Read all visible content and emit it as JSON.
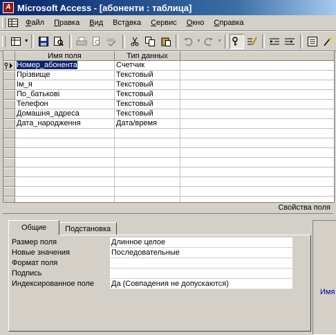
{
  "window": {
    "title": "Microsoft Access - [абоненти : таблица]"
  },
  "menubar": {
    "items": [
      {
        "pre": "",
        "u": "Ф",
        "post": "айл"
      },
      {
        "pre": "",
        "u": "П",
        "post": "равка"
      },
      {
        "pre": "",
        "u": "В",
        "post": "ид"
      },
      {
        "pre": "Вст",
        "u": "а",
        "post": "вка"
      },
      {
        "pre": "",
        "u": "С",
        "post": "ервис"
      },
      {
        "pre": "",
        "u": "О",
        "post": "кно"
      },
      {
        "pre": "",
        "u": "С",
        "post": "правка"
      }
    ]
  },
  "grid": {
    "headers": {
      "field_name": "Имя поля",
      "data_type": "Тип данных",
      "description": ""
    },
    "rows": [
      {
        "name": "Номер_абонента",
        "type": "Счетчик"
      },
      {
        "name": "Прізвище",
        "type": "Текстовый"
      },
      {
        "name": "Ім_я",
        "type": "Текстовый"
      },
      {
        "name": "По_батькові",
        "type": "Текстовый"
      },
      {
        "name": "Телефон",
        "type": "Текстовый"
      },
      {
        "name": "Домашня_адреса",
        "type": "Текстовый"
      },
      {
        "name": "Дата_народження",
        "type": "Дата/время"
      }
    ],
    "empty_row_count": 8
  },
  "properties": {
    "section_label": "Свойства поля",
    "tabs": [
      "Общие",
      "Подстановка"
    ],
    "fields": [
      {
        "label": "Размер поля",
        "value": "Длинное целое"
      },
      {
        "label": "Новые значения",
        "value": "Последовательные"
      },
      {
        "label": "Формат поля",
        "value": ""
      },
      {
        "label": "Подпись",
        "value": ""
      },
      {
        "label": "Индексированное поле",
        "value": "Да (Совпадения не допускаются)"
      }
    ],
    "hint_text": "Имя"
  }
}
